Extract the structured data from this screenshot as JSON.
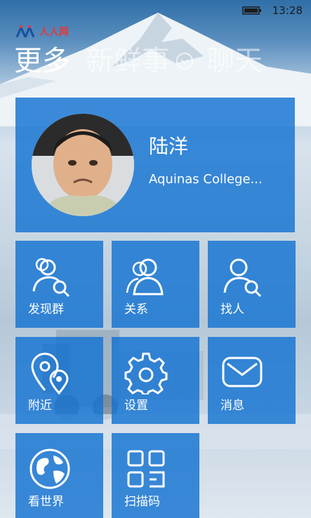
{
  "status_bar": {
    "time": "13:28"
  },
  "app": {
    "logo_text": "人人网"
  },
  "pivot": {
    "items": [
      {
        "label": "更多",
        "active": true
      },
      {
        "label": "新鲜事",
        "active": false
      },
      {
        "label": "聊天",
        "active": false
      }
    ]
  },
  "profile": {
    "name": "陆洋",
    "school": "Aquinas College..."
  },
  "tiles": [
    {
      "label": "发现群",
      "icon": "find-group-icon"
    },
    {
      "label": "关系",
      "icon": "relations-icon"
    },
    {
      "label": "找人",
      "icon": "find-people-icon"
    },
    {
      "label": "附近",
      "icon": "nearby-icon"
    },
    {
      "label": "设置",
      "icon": "settings-icon"
    },
    {
      "label": "消息",
      "icon": "message-icon"
    },
    {
      "label": "看世界",
      "icon": "globe-icon"
    },
    {
      "label": "扫描码",
      "icon": "qr-scan-icon"
    }
  ],
  "colors": {
    "tile": "#1473d2",
    "accent": "#ffffff",
    "logo": "#e33b3b"
  }
}
